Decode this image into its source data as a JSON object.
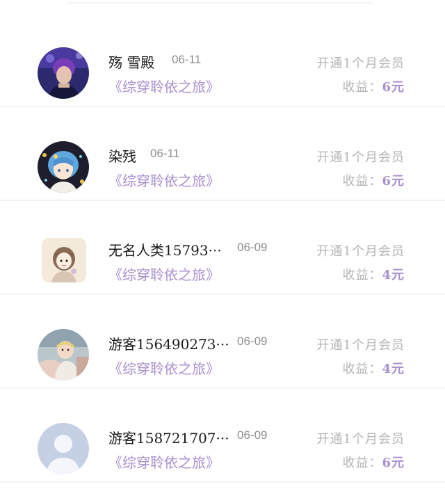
{
  "records": [
    {
      "name": "殇 雪殿",
      "date": "06-11",
      "book": "《综穿聆依之旅》",
      "desc": "开通1个月会员",
      "earn_label": "收益：",
      "earn_amount": "6元",
      "avatar_icon": "user-photo-avatar"
    },
    {
      "name": "染残",
      "date": "06-11",
      "book": "《综穿聆依之旅》",
      "desc": "开通1个月会员",
      "earn_label": "收益：",
      "earn_amount": "6元",
      "avatar_icon": "anime-girl-avatar"
    },
    {
      "name": "无名人类15793···",
      "date": "06-09",
      "book": "《综穿聆依之旅》",
      "desc": "开通1个月会员",
      "earn_label": "收益：",
      "earn_amount": "4元",
      "avatar_icon": "cartoon-girl-avatar"
    },
    {
      "name": "游客156490273···",
      "date": "06-09",
      "book": "《综穿聆依之旅》",
      "desc": "开通1个月会员",
      "earn_label": "收益：",
      "earn_amount": "4元",
      "avatar_icon": "baby-photo-avatar"
    },
    {
      "name": "游客158721707···",
      "date": "06-09",
      "book": "《综穿聆依之旅》",
      "desc": "开通1个月会员",
      "earn_label": "收益：",
      "earn_amount": "6元",
      "avatar_icon": "default-person-avatar"
    }
  ],
  "colors": {
    "accent": "#a98fcf",
    "muted": "#b4b4b8",
    "date": "#8e8e93",
    "name": "#1a1a1a"
  }
}
